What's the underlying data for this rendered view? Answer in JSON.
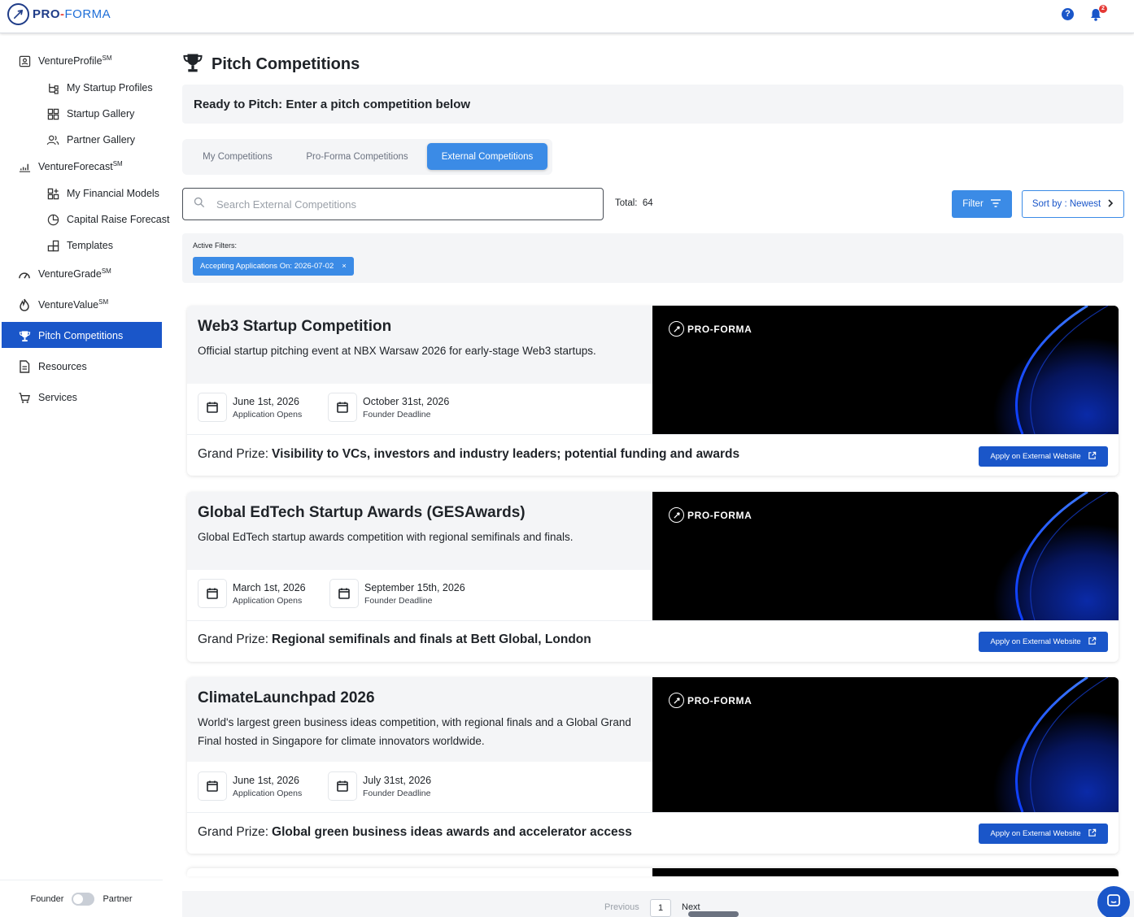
{
  "app": {
    "brand_pro": "PRO",
    "brand_dash": "-",
    "brand_forma": "FORMA",
    "help_label": "?",
    "notification_count": "2"
  },
  "sidebar": {
    "items": [
      {
        "label": "VentureProfile",
        "sup": "SM"
      },
      {
        "label": "My Startup Profiles"
      },
      {
        "label": "Startup Gallery"
      },
      {
        "label": "Partner Gallery"
      },
      {
        "label": "VentureForecast",
        "sup": "SM"
      },
      {
        "label": "My Financial Models"
      },
      {
        "label": "Capital Raise Forecast"
      },
      {
        "label": "Templates"
      },
      {
        "label": "VentureGrade",
        "sup": "SM"
      },
      {
        "label": "VentureValue",
        "sup": "SM"
      },
      {
        "label": "Pitch Competitions",
        "active": true
      },
      {
        "label": "Resources"
      },
      {
        "label": "Services"
      }
    ],
    "toggle": {
      "left": "Founder",
      "right": "Partner"
    }
  },
  "main": {
    "title": "Pitch Competitions",
    "banner": "Ready to Pitch: Enter a pitch competition below",
    "tabs": [
      "My Competitions",
      "Pro-Forma Competitions",
      "External Competitions"
    ],
    "active_tab": "External Competitions",
    "search": {
      "placeholder": "Search External Competitions",
      "value": ""
    },
    "total_label": "Total:",
    "total_value": "64",
    "filter_label": "Filter",
    "sort_label": "Sort by : Newest",
    "active_filters_label": "Active Filters:",
    "active_filter_chip": "Accepting Applications On: 2026-07-02",
    "chip_remove": "×"
  },
  "cards": [
    {
      "title": "Web3 Startup Competition",
      "description": "Official startup pitching event at NBX Warsaw 2026 for early-stage Web3 startups.",
      "open_date": "June 1st, 2026",
      "open_label": "Application Opens",
      "deadline_date": "October 31st, 2026",
      "deadline_label": "Founder Deadline",
      "prize_label": "Grand Prize:",
      "prize": "Visibility to VCs, investors and industry leaders; potential funding and awards",
      "apply_label": "Apply on External Website",
      "image_brand": "PRO-FORMA"
    },
    {
      "title": "Global EdTech Startup Awards (GESAwards)",
      "description": "Global EdTech startup awards competition with regional semifinals and finals.",
      "open_date": "March 1st, 2026",
      "open_label": "Application Opens",
      "deadline_date": "September 15th, 2026",
      "deadline_label": "Founder Deadline",
      "prize_label": "Grand Prize:",
      "prize": "Regional semifinals and finals at Bett Global, London",
      "apply_label": "Apply on External Website",
      "image_brand": "PRO-FORMA"
    },
    {
      "title": "ClimateLaunchpad 2026",
      "description": "World's largest green business ideas competition, with regional finals and a Global Grand Final hosted in Singapore for climate innovators worldwide.",
      "open_date": "June 1st, 2026",
      "open_label": "Application Opens",
      "deadline_date": "July 31st, 2026",
      "deadline_label": "Founder Deadline",
      "prize_label": "Grand Prize:",
      "prize": "Global green business ideas awards and accelerator access",
      "apply_label": "Apply on External Website",
      "image_brand": "PRO-FORMA"
    }
  ],
  "pagination": {
    "previous": "Previous",
    "page": "1",
    "next": "Next"
  },
  "colors": {
    "primary": "#1a56c9",
    "accent": "#3b8be6",
    "panel": "#f4f5f7"
  }
}
